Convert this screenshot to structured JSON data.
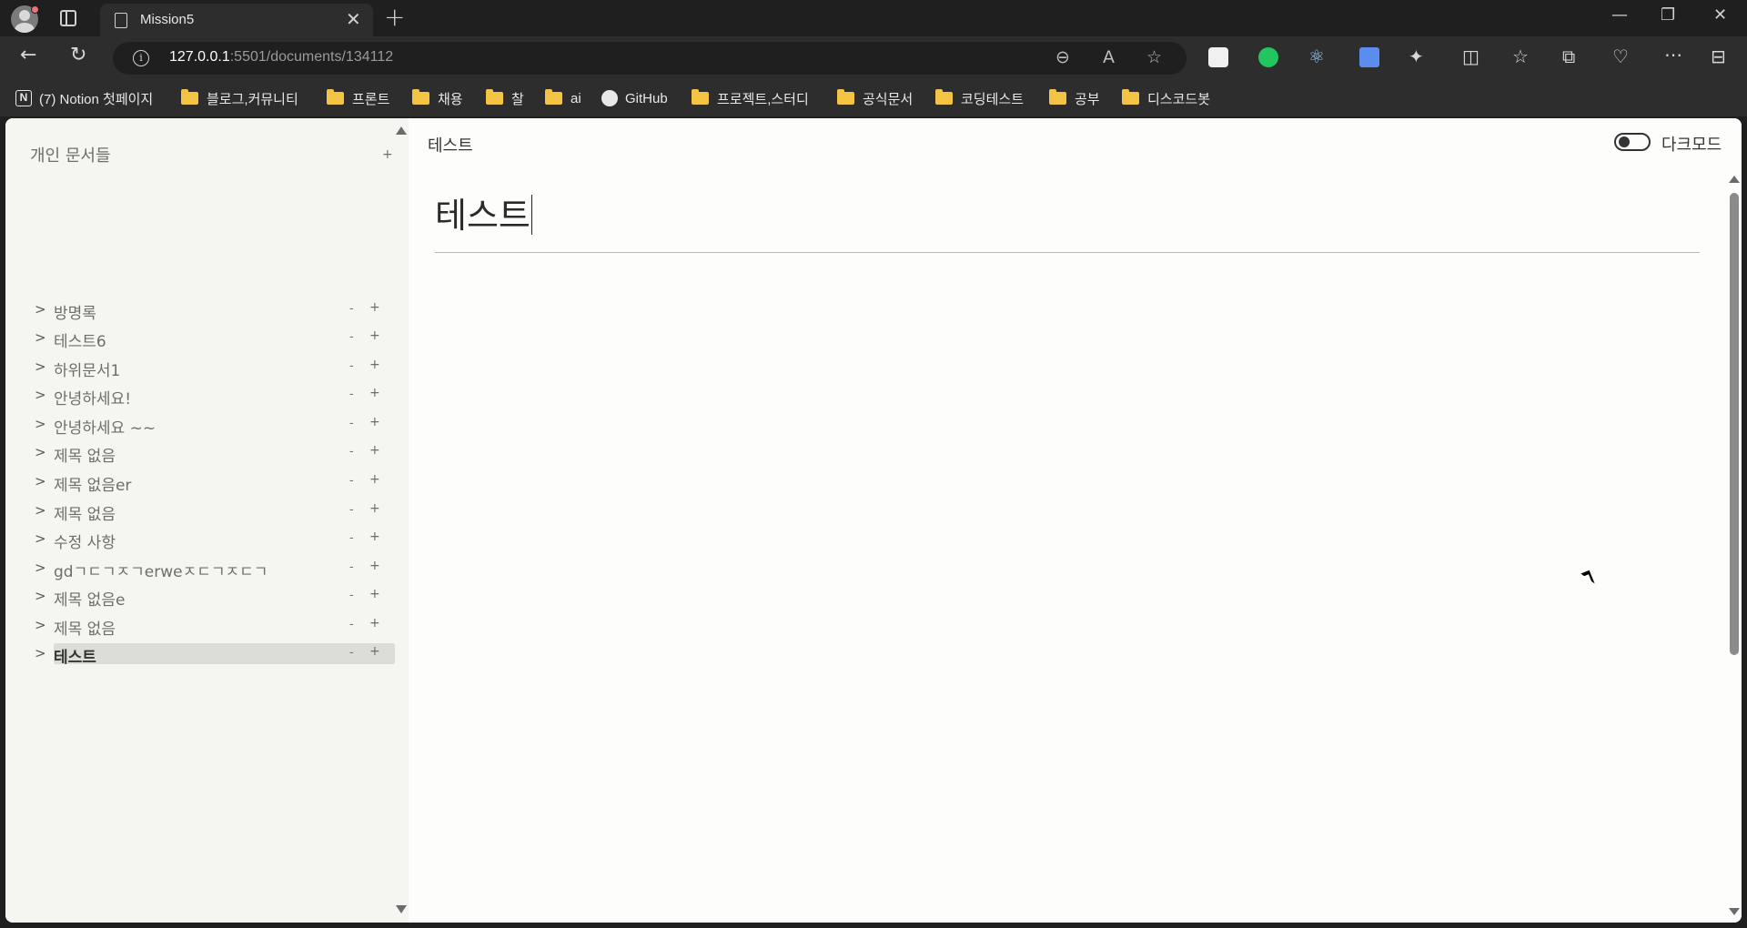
{
  "browser": {
    "tab_title": "Mission5",
    "url_host": "127.0.0.1",
    "url_path": ":5501/documents/134112",
    "bookmarks": [
      {
        "label": "(7) Notion 첫페이지",
        "icon": "notion-icon"
      },
      {
        "label": "블로그,커뮤니티",
        "icon": "folder-icon"
      },
      {
        "label": "프론트",
        "icon": "folder-icon"
      },
      {
        "label": "채용",
        "icon": "folder-icon"
      },
      {
        "label": "찰",
        "icon": "folder-icon"
      },
      {
        "label": "ai",
        "icon": "folder-icon"
      },
      {
        "label": "GitHub",
        "icon": "github-icon"
      },
      {
        "label": "프로젝트,스터디",
        "icon": "folder-icon"
      },
      {
        "label": "공식문서",
        "icon": "folder-icon"
      },
      {
        "label": "코딩테스트",
        "icon": "folder-icon"
      },
      {
        "label": "공부",
        "icon": "folder-icon"
      },
      {
        "label": "디스코드봇",
        "icon": "folder-icon"
      }
    ]
  },
  "sidebar": {
    "header": "개인 문서들",
    "add_label": "+",
    "documents": [
      {
        "arrow": ">",
        "title": "방명록",
        "minus": "-",
        "plus": "+"
      },
      {
        "arrow": ">",
        "title": "테스트6",
        "minus": "-",
        "plus": "+"
      },
      {
        "arrow": ">",
        "title": "하위문서1",
        "minus": "-",
        "plus": "+"
      },
      {
        "arrow": ">",
        "title": "안녕하세요!",
        "minus": "-",
        "plus": "+"
      },
      {
        "arrow": ">",
        "title": "안녕하세요 ~~",
        "minus": "-",
        "plus": "+"
      },
      {
        "arrow": ">",
        "title": "제목 없음",
        "minus": "-",
        "plus": "+"
      },
      {
        "arrow": ">",
        "title": "제목 없음er",
        "minus": "-",
        "plus": "+"
      },
      {
        "arrow": ">",
        "title": "제목 없음",
        "minus": "-",
        "plus": "+"
      },
      {
        "arrow": ">",
        "title": "수정 사항",
        "minus": "-",
        "plus": "+"
      },
      {
        "arrow": ">",
        "title": "gdㄱㄷㄱㅈㄱerweㅈㄷㄱㅈㄷㄱ",
        "minus": "-",
        "plus": "+"
      },
      {
        "arrow": ">",
        "title": "제목 없음e",
        "minus": "-",
        "plus": "+"
      },
      {
        "arrow": ">",
        "title": "제목 없음",
        "minus": "-",
        "plus": "+"
      },
      {
        "arrow": ">",
        "title": "테스트",
        "minus": "-",
        "plus": "+",
        "active": true
      }
    ]
  },
  "main": {
    "breadcrumb": "테스트",
    "dark_mode_label": "다크모드",
    "dark_mode_on": false,
    "document_title": "테스트"
  },
  "colors": {
    "sidebar_bg": "#f5f5f1",
    "content_bg": "#fdfdfb",
    "active_item_bg": "#dcdcd8",
    "text": "#37352f",
    "folder": "#f3c343"
  }
}
